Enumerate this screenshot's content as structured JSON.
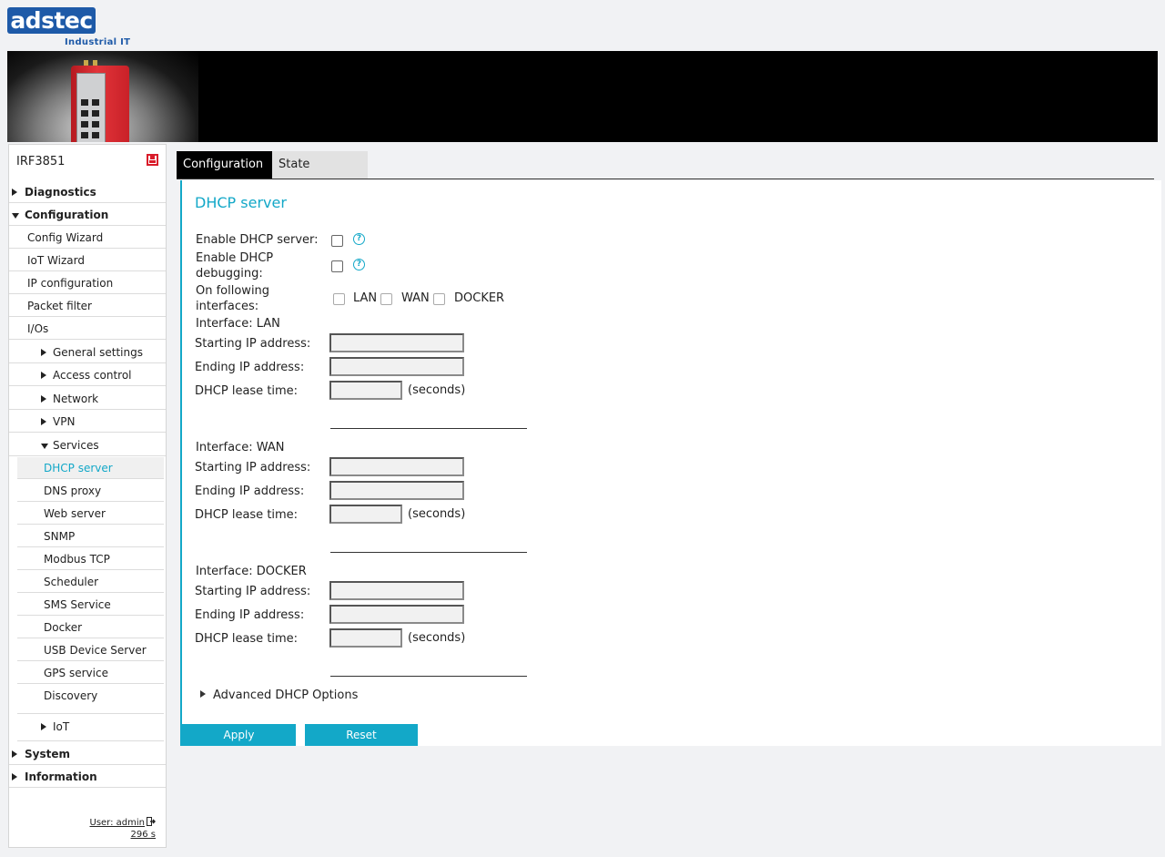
{
  "brand": {
    "logo_text": "adstec",
    "subtitle": "Industrial IT"
  },
  "sidebar": {
    "device_name": "IRF3851",
    "items": [
      {
        "label": "Diagnostics"
      },
      {
        "label": "Configuration"
      },
      {
        "label": "Config Wizard"
      },
      {
        "label": "IoT Wizard"
      },
      {
        "label": "IP configuration"
      },
      {
        "label": "Packet filter"
      },
      {
        "label": "I/Os"
      },
      {
        "label": "General settings"
      },
      {
        "label": "Access control"
      },
      {
        "label": "Network"
      },
      {
        "label": "VPN"
      },
      {
        "label": "Services"
      },
      {
        "label": "DHCP server"
      },
      {
        "label": "DNS proxy"
      },
      {
        "label": "Web server"
      },
      {
        "label": "SNMP"
      },
      {
        "label": "Modbus TCP"
      },
      {
        "label": "Scheduler"
      },
      {
        "label": "SMS Service"
      },
      {
        "label": "Docker"
      },
      {
        "label": "USB Device Server"
      },
      {
        "label": "GPS service"
      },
      {
        "label": "Discovery"
      },
      {
        "label": "IoT"
      },
      {
        "label": "System"
      },
      {
        "label": "Information"
      }
    ],
    "user": "User: admin",
    "session": "296 s"
  },
  "tabs": [
    {
      "label": "Configuration",
      "active": true
    },
    {
      "label": "State",
      "active": false
    }
  ],
  "main": {
    "title": "DHCP server",
    "enable_label": "Enable DHCP server:",
    "debug_label_1": "Enable DHCP",
    "debug_label_2": "debugging:",
    "interfaces_label_1": "On following",
    "interfaces_label_2": "interfaces:",
    "interface_options": [
      "LAN",
      "WAN",
      "DOCKER"
    ],
    "help_glyph": "?",
    "sections": [
      {
        "title": "Interface: LAN",
        "start_label": "Starting IP address:",
        "start_value": "",
        "end_label": "Ending IP address:",
        "end_value": "",
        "lease_label": "DHCP lease time:",
        "lease_value": "",
        "lease_unit": "(seconds)"
      },
      {
        "title": "Interface: WAN",
        "start_label": "Starting IP address:",
        "start_value": "",
        "end_label": "Ending IP address:",
        "end_value": "",
        "lease_label": "DHCP lease time:",
        "lease_value": "",
        "lease_unit": "(seconds)"
      },
      {
        "title": "Interface: DOCKER",
        "start_label": "Starting IP address:",
        "start_value": "",
        "end_label": "Ending IP address:",
        "end_value": "",
        "lease_label": "DHCP lease time:",
        "lease_value": "",
        "lease_unit": "(seconds)"
      }
    ],
    "advanced_label": "Advanced DHCP Options",
    "apply_label": "Apply",
    "reset_label": "Reset"
  },
  "colors": {
    "accent": "#13a8c8",
    "brand_blue": "#1e5aa8",
    "save_red": "#d91c2a"
  }
}
